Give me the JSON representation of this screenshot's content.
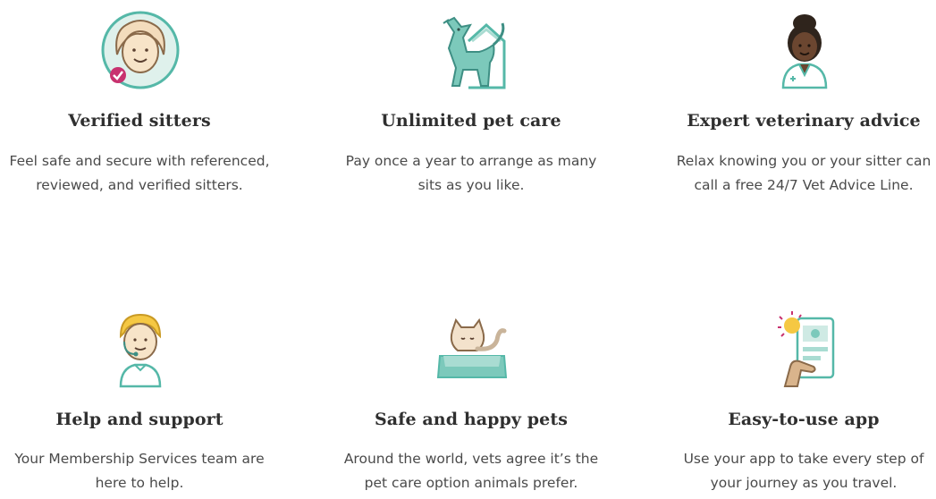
{
  "features": [
    {
      "title": "Verified sitters",
      "description": "Feel safe and secure with referenced, reviewed, and verified sitters."
    },
    {
      "title": "Unlimited pet care",
      "description": "Pay once a year to arrange as many sits as you like."
    },
    {
      "title": "Expert veterinary advice",
      "description": "Relax knowing you or your sitter can call a free 24/7 Vet Advice Line."
    },
    {
      "title": "Help and support",
      "description": "Your Membership Services team are here to help."
    },
    {
      "title": "Safe and happy pets",
      "description": "Around the world, vets agree it’s the pet care option animals prefer."
    },
    {
      "title": "Easy-to-use app",
      "description": "Use your app to take every step of your journey as you travel."
    }
  ],
  "icons": [
    "verified-sitter-icon",
    "dog-and-house-icon",
    "vet-icon",
    "support-agent-icon",
    "cat-in-bed-icon",
    "phone-app-icon"
  ],
  "colors": {
    "teal": "#55b8a8",
    "light_teal": "#a9dcd2",
    "pink": "#c8326f",
    "skin": "#f3dcbc",
    "dark_skin": "#5a3825",
    "yellow": "#f5c843",
    "heading": "#2f2f2f",
    "text": "#4a4a4a"
  }
}
